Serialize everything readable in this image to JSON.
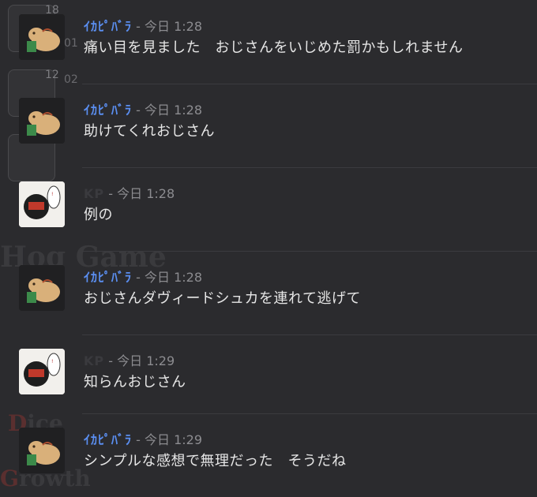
{
  "background": {
    "words": [
      "Hog Game",
      "Dice",
      "Growth"
    ]
  },
  "rail": {
    "tiles": [
      {
        "badge": "18",
        "tag": "01"
      },
      {
        "badge": "12",
        "tag": "02"
      },
      {
        "badge": "",
        "tag": ""
      }
    ]
  },
  "date_label": "今日",
  "separator": "-",
  "messages": [
    {
      "author": "ｲｶﾋﾟﾊﾞﾗ",
      "time": "1:28",
      "text": "痛い目を見ました　おじさんをいじめた罰かもしれません",
      "avatar": "capybara-avatar"
    },
    {
      "author": "ｲｶﾋﾟﾊﾞﾗ",
      "time": "1:28",
      "text": "助けてくれおじさん",
      "avatar": "capybara-avatar"
    },
    {
      "author": "KP",
      "time": "1:28",
      "text": "例の",
      "avatar": "kp-avatar"
    },
    {
      "author": "ｲｶﾋﾟﾊﾞﾗ",
      "time": "1:28",
      "text": "おじさんダヴィードシュカを連れて逃げて",
      "avatar": "capybara-avatar"
    },
    {
      "author": "KP",
      "time": "1:29",
      "text": "知らんおじさん",
      "avatar": "kp-avatar"
    },
    {
      "author": "ｲｶﾋﾟﾊﾞﾗ",
      "time": "1:29",
      "text": "シンプルな感想で無理だった　そうだね",
      "avatar": "capybara-avatar"
    }
  ],
  "colors": {
    "background": "#2b2b2e",
    "author_accent": "#5b8ff2",
    "message_text": "#e6e6e6",
    "meta_text": "#8c8c90"
  }
}
